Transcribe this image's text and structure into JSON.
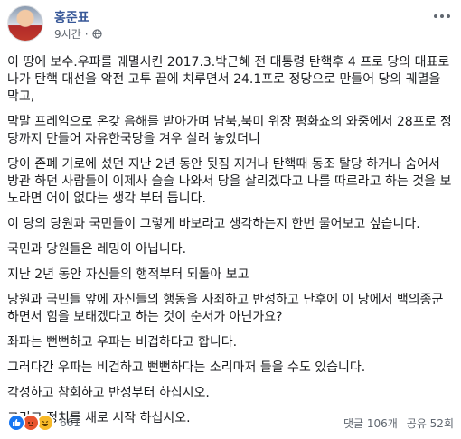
{
  "post": {
    "author": "홍준표",
    "time": "9시간",
    "paragraphs": [
      "이 땅에 보수.우파를 궤멸시킨 2017.3.박근혜 전 대통령 탄핵후 4 프로 당의 대표로 나가 탄핵 대선을 악전 고투 끝에 치루면서 24.1프로 정당으로 만들어 당의 궤멸을 막고,",
      "막말 프레임으로 온갖 음해를 받아가며 남북,북미 위장 평화쇼의 와중에서 28프로 정당까지 만들어 자유한국당을 겨우 살려 놓았더니",
      "당이 존폐 기로에 섰던 지난 2년 동안 뒷짐 지거나 탄핵때 동조 탈당 하거나 숨어서 방관 하던 사람들이 이제사 슬슬 나와서 당을 살리겠다고 나를 따르라고 하는 것을 보노라면 어이 없다는 생각 부터 듭니다.",
      "이 당의 당원과 국민들이 그렇게 바보라고 생각하는지 한번 물어보고 싶습니다.",
      "국민과 당원들은 레밍이 아닙니다.",
      "지난 2년 동안 자신들의 행적부터 되돌아 보고",
      "당원과 국민들 앞에 자신들의 행동을 사죄하고 반성하고 난후에 이 당에서 백의종군 하면서 힘을 보태겠다고 하는 것이 순서가 아닌가요?",
      "좌파는 뻔뻔하고 우파는 비겁하다고 합니다.",
      "그러다간 우파는 비겁하고 뻔뻔하다는 소리마저 들을 수도 있습니다.",
      "각성하고 참회하고 반성부터 하십시오.",
      "그리고 정치를 새로 시작 하십시오."
    ]
  },
  "footer": {
    "reaction_count": "661",
    "comments": "댓글 106개",
    "shares": "공유 52회"
  },
  "icons": {
    "avatar": "profile-photo",
    "privacy": "globe-icon",
    "more": "more-options-icon",
    "reactions": [
      "like-icon",
      "angry-icon",
      "haha-icon"
    ]
  },
  "colors": {
    "author": "#385898",
    "text": "#1c1e21",
    "meta": "#606770",
    "like": "#1877f2",
    "angry": "#e8542f",
    "haha": "#f7b928"
  }
}
